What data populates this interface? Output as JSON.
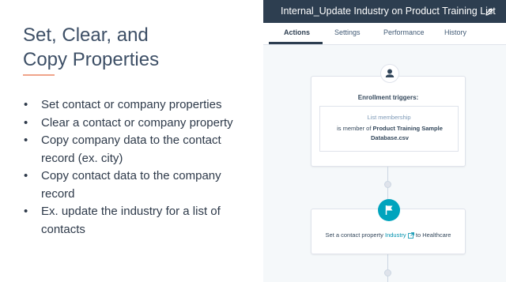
{
  "slide": {
    "title_line1": "Set, Clear, and",
    "title_line2": "Copy Properties",
    "bullets": [
      "Set contact or company properties",
      "Clear a contact or company property",
      "Copy company data to the contact record (ex. city)",
      "Copy contact data to the company record",
      "Ex. update the industry for a list of contacts"
    ]
  },
  "workflow": {
    "title": "Internal_Update Industry on Product Training List",
    "tabs": [
      "Actions",
      "Settings",
      "Performance",
      "History"
    ],
    "active_tab": "Actions",
    "trigger": {
      "heading": "Enrollment triggers:",
      "label": "List membership",
      "prefix": "is member of",
      "list_name": "Product Training Sample Database.csv"
    },
    "action": {
      "prefix": "Set a contact property",
      "property": "Industry",
      "suffix": "to Healthcare"
    }
  },
  "colors": {
    "header_bg": "#2d3e50",
    "accent_teal": "#00a4bd",
    "link": "#0091ae",
    "title_rule": "#f0a48a"
  },
  "icons": [
    "edit-icon",
    "contact-icon",
    "flag-icon",
    "external-link-icon"
  ]
}
